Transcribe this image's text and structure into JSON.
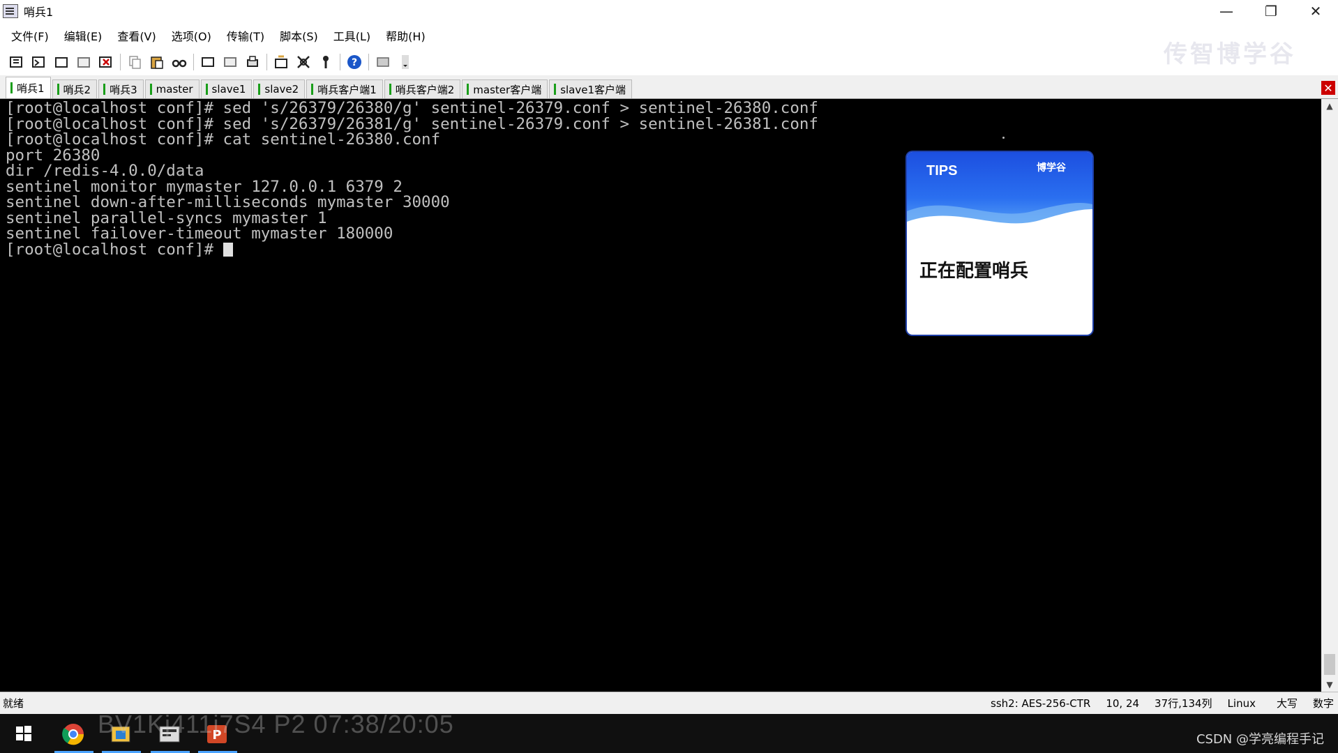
{
  "window": {
    "title": "哨兵1",
    "controls": [
      "—",
      "❐",
      "✕"
    ]
  },
  "menu": [
    "文件(F)",
    "编辑(E)",
    "查看(V)",
    "选项(O)",
    "传输(T)",
    "脚本(S)",
    "工具(L)",
    "帮助(H)"
  ],
  "watermark_top": "传智博学谷",
  "tabs": [
    {
      "label": "哨兵1",
      "active": true
    },
    {
      "label": "哨兵2",
      "active": false
    },
    {
      "label": "哨兵3",
      "active": false
    },
    {
      "label": "master",
      "active": false
    },
    {
      "label": "slave1",
      "active": false
    },
    {
      "label": "slave2",
      "active": false
    },
    {
      "label": "哨兵客户端1",
      "active": false
    },
    {
      "label": "哨兵客户端2",
      "active": false
    },
    {
      "label": "master客户端",
      "active": false
    },
    {
      "label": "slave1客户端",
      "active": false
    }
  ],
  "terminal": {
    "lines": [
      "[root@localhost conf]# sed 's/26379/26380/g' sentinel-26379.conf > sentinel-26380.conf",
      "[root@localhost conf]# sed 's/26379/26381/g' sentinel-26379.conf > sentinel-26381.conf",
      "[root@localhost conf]# cat sentinel-26380.conf",
      "port 26380",
      "dir /redis-4.0.0/data",
      "sentinel monitor mymaster 127.0.0.1 6379 2",
      "sentinel down-after-milliseconds mymaster 30000",
      "sentinel parallel-syncs mymaster 1",
      "sentinel failover-timeout mymaster 180000"
    ],
    "prompt": "[root@localhost conf]# "
  },
  "tips": {
    "label": "TIPS",
    "brand": "博学谷",
    "message": "正在配置哨兵"
  },
  "status": {
    "left": "就绪",
    "cipher": "ssh2: AES-256-CTR",
    "cursor_pos": "10,  24",
    "size": "37行,134列",
    "os": "Linux",
    "caps": "大写",
    "num": "数字"
  },
  "overlay_code": "BV1Kj411i7S4 P2 07:38/20:05",
  "csdn": "CSDN @学亮编程手记"
}
